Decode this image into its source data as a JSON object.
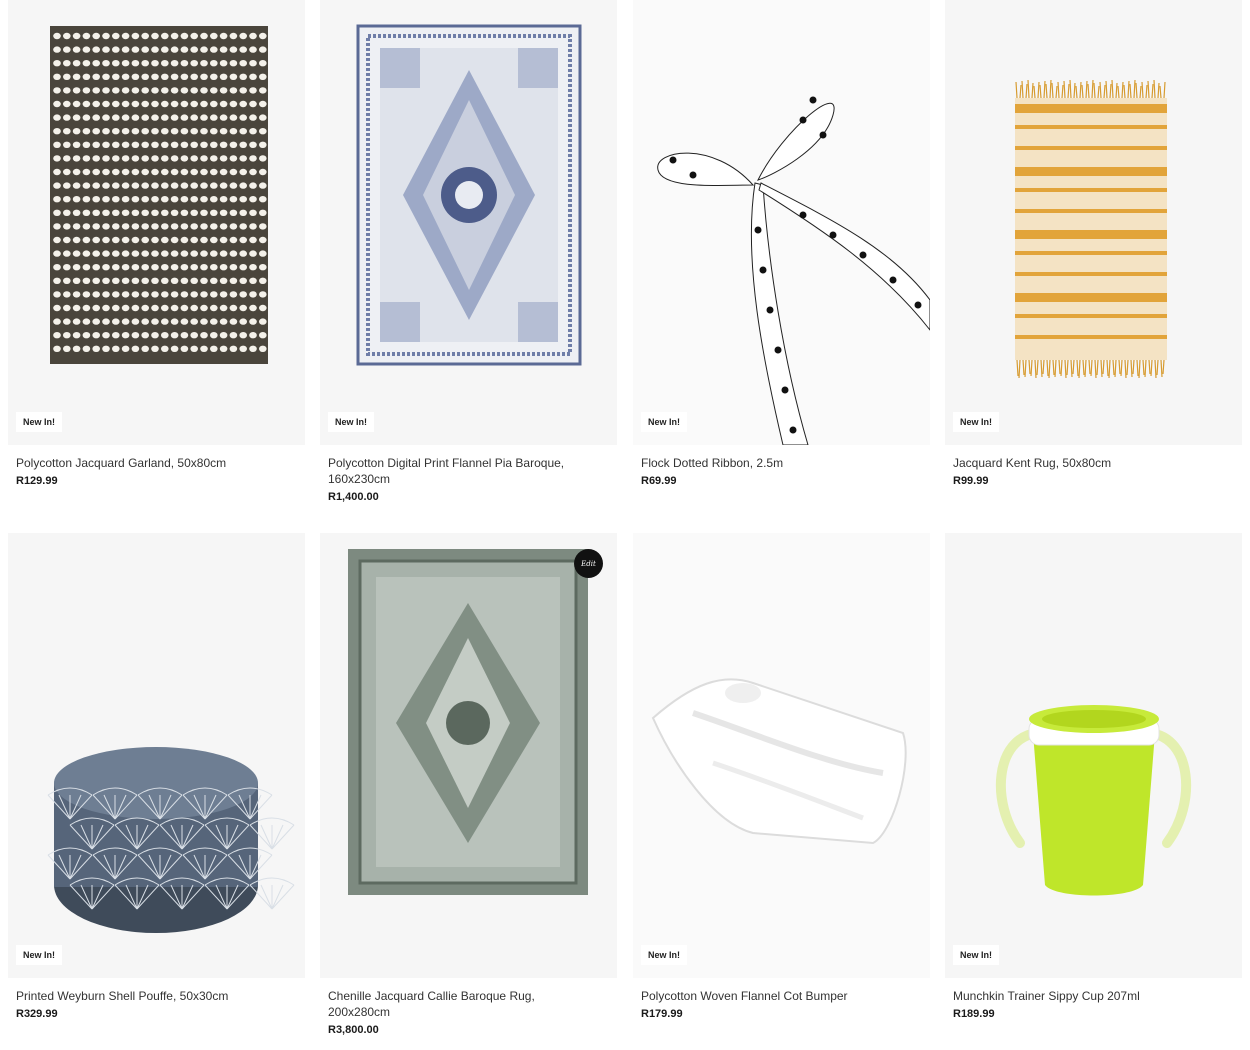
{
  "products": [
    {
      "title": "Polycotton Jacquard Garland, 50x80cm",
      "price": "R129.99",
      "badge": "New In!",
      "image_icon": "striped-rug-image"
    },
    {
      "title": "Polycotton Digital Print Flannel Pia Baroque, 160x230cm",
      "price": "R1,400.00",
      "badge": "New In!",
      "image_icon": "baroque-rug-image"
    },
    {
      "title": "Flock Dotted Ribbon, 2.5m",
      "price": "R69.99",
      "badge": "New In!",
      "image_icon": "dotted-ribbon-image"
    },
    {
      "title": "Jacquard Kent Rug, 50x80cm",
      "price": "R99.99",
      "badge": "New In!",
      "image_icon": "striped-yellow-rug-image"
    },
    {
      "title": "Printed Weyburn Shell Pouffe, 50x30cm",
      "price": "R329.99",
      "badge": "New In!",
      "image_icon": "pouffe-image"
    },
    {
      "title": "Chenille Jacquard Callie Baroque Rug, 200x280cm",
      "price": "R3,800.00",
      "badge": "",
      "brand_mark": "Edit",
      "image_icon": "green-baroque-rug-image"
    },
    {
      "title": "Polycotton Woven Flannel Cot Bumper",
      "price": "R179.99",
      "badge": "New In!",
      "image_icon": "cot-bumper-image"
    },
    {
      "title": "Munchkin Trainer Sippy Cup 207ml",
      "price": "R189.99",
      "badge": "New In!",
      "image_icon": "sippy-cup-image"
    }
  ]
}
